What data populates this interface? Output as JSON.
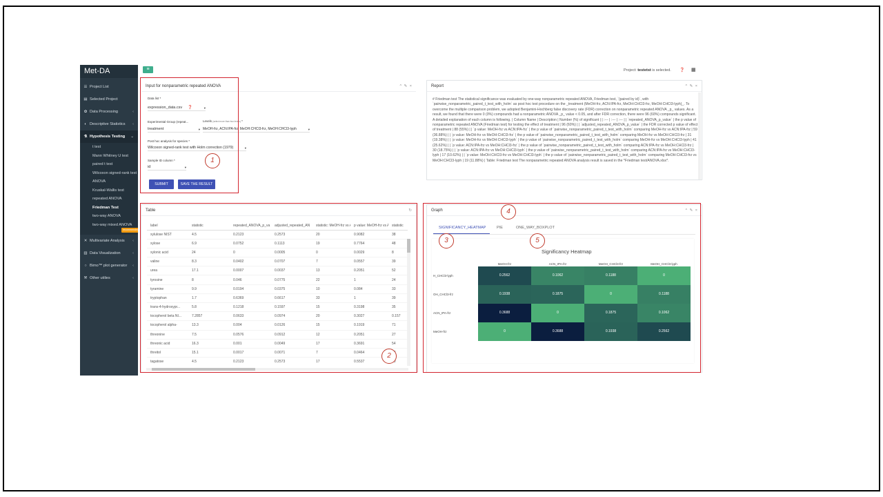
{
  "app": {
    "title": "Met-DA"
  },
  "sidebar": {
    "items": [
      {
        "label": "Project List",
        "icon": "list-icon"
      },
      {
        "label": "Selected Project",
        "icon": "file-icon"
      },
      {
        "label": "Data Processing",
        "icon": "gear-icon"
      },
      {
        "label": "Descriptive Statistics",
        "icon": "stats-icon"
      }
    ],
    "active": {
      "label": "Hypothesis Testing",
      "icon": "flask-icon"
    },
    "subitems": [
      "t test",
      "Mann Whitney U test",
      "paired t test",
      "Wilcoxon signed-rank test",
      "ANOVA",
      "Kruskal-Wallis test",
      "repeated ANOVA",
      "Friedman Test",
      "two-way ANOVA",
      "two-way mixed ANOVA"
    ],
    "sub_badge": "recommended",
    "items_after": [
      {
        "label": "Multivariate Analysis",
        "icon": "multivariate-icon"
      },
      {
        "label": "Data Visualization",
        "icon": "chart-icon"
      },
      {
        "label": "Bimo™ plot generator",
        "icon": "circle-icon"
      },
      {
        "label": "Other utilies",
        "icon": "wrench-icon"
      }
    ]
  },
  "topbar": {
    "status_prefix": "Project: ",
    "project_name": "testetst",
    "status_suffix": " is selected."
  },
  "input_panel": {
    "title": "Input for nonparametric repeated ANOVA",
    "data_list_label": "Data list *",
    "data_list_value": "expression_data.csv",
    "group_label": "Experimental Group (repeat...",
    "group_value": "treatment",
    "levels_label": "Levels",
    "levels_hint": "(select more than two levels)",
    "levels_req": " *",
    "levels_value": "MeOH-frz, ACN:IPA-frz, MeOH:CHCl3-frz, MeOH:CHCl3-lyph",
    "posthoc_label": "Post hoc analysis for species *",
    "posthoc_value": "Wilcoxon signed-rank test with Holm correction (1979)",
    "sample_label": "Sample ID column *",
    "sample_value": "id",
    "submit_label": "SUBMIT",
    "save_label": "SAVE THE RESULT"
  },
  "report_panel": {
    "title": "Report",
    "text": "# Friedman test The statistical significance was evaluated by one-way nonparametric repeated ANOVA, Friedman test, `(paired by id)`, with `pairwise_nonparametric_paired_t_test_with_holm` as post hoc test procedure on the _treatment (MeOH-frz, ACN:IPA-frz, MeOH:CHCl3-frz, MeOH:CHCl3-lyph)_. To overcome the multiple comparison problem, we adopted Benjamini-Hochberg false discovery rate (FDR) correction on nonparametric repeated ANOVA _p_ values. As a result, we found that there were 0 (0%) compounds had a nonparametric ANOVA _p_ value < 0.05, and after FDR correction, there were 96 (60%) compounds significant. A detailed explanation of each column is following. | Column Name | Description | Number (%) of significant | | :--- | :--- | :--- | | `repeated_ANOVA_p_value` | the p value of nonparametric repeated ANOVA (Friedman test) for testing the effect of treatment | 96 (60%) | | `adjusted_repeated_ANOVA_p_value` | the FDR corrected p value of effect of treatment | 88 (55%) | | `p value: MeOH-frz vs ACN:IPA-frz` | the p value of `pairwise_nonparametric_paired_t_test_with_holm` comparing MeOH-frz vs ACN:IPA-frz | 59 (36.88%) | | `p value: MeOH-frz vs MeOH:CHCl3-frz` | the p value of `pairwise_nonparametric_paired_t_test_with_holm` comparing MeOH-frz vs MeOH:CHCl3-frz | 31 (19.38%) | | `p value: MeOH-frz vs MeOH:CHCl3-lyph` | the p value of `pairwise_nonparametric_paired_t_test_with_holm` comparing MeOH-frz vs MeOH:CHCl3-lyph | 41 (25.62%) | | `p value: ACN:IPA-frz vs MeOH:CHCl3-frz` | the p value of `pairwise_nonparametric_paired_t_test_with_holm` comparing ACN:IPA-frz vs MeOH:CHCl3-frz | 30 (18.75%) | | `p value: ACN:IPA-frz vs MeOH:CHCl3-lyph` | the p value of `pairwise_nonparametric_paired_t_test_with_holm` comparing ACN:IPA-frz vs MeOH:CHCl3-lyph | 17 (10.62%) | | `p value: MeOH:CHCl3-frz vs MeOH:CHCl3-lyph` | the p value of `pairwise_nonparametric_paired_t_test_with_holm` comparing MeOH:CHCl3-frz vs MeOH:CHCl3-lyph | 19 (11.88%) | Table: Friedman test The nonparametric repeated ANOVA analysis result is saved in the *Friedman test/ANOVA.xlsx*."
  },
  "table_panel": {
    "title": "Table",
    "columns": [
      "label",
      "statistic",
      "repeated_ANOVA_p_va",
      "adjusted_repeated_AN",
      "statistic: MeOH-frz vs A",
      "p value: MeOH-frz vs A",
      "statistic"
    ],
    "rows": [
      [
        "xylulose NIST",
        "4.5",
        "0.2123",
        "0.2573",
        "20",
        "0.9082",
        "38"
      ],
      [
        "xylose",
        "6.9",
        "0.0752",
        "0.1113",
        "19",
        "0.7764",
        "48"
      ],
      [
        "xylonic acid",
        "24",
        "0",
        "0.0005",
        "0",
        "0.0029",
        "8"
      ],
      [
        "valine",
        "8.3",
        "0.0402",
        "0.0707",
        "7",
        "0.0557",
        "39"
      ],
      [
        "urea",
        "17.1",
        "0.0007",
        "0.0037",
        "13",
        "0.2051",
        "52"
      ],
      [
        "tyrosine",
        "8",
        "0.046",
        "0.0775",
        "22",
        "1",
        "24"
      ],
      [
        "tyramine",
        "9.9",
        "0.0194",
        "0.0375",
        "10",
        "0.084",
        "33"
      ],
      [
        "tryptophan",
        "1.7",
        "0.6369",
        "0.6617",
        "33",
        "1",
        "39"
      ],
      [
        "trans-4-hydroxypr...",
        "5.8",
        "0.1218",
        "0.1597",
        "15",
        "0.3198",
        "35"
      ],
      [
        "tocopherol beta NI...",
        "7.2857",
        "0.0633",
        "0.0974",
        "20",
        "0.3027",
        "0.157"
      ],
      [
        "tocopherol alpha-",
        "13.3",
        "0.004",
        "0.0126",
        "15",
        "0.1919",
        "71"
      ],
      [
        "threonine",
        "7.5",
        "0.0576",
        "0.0912",
        "12",
        "0.2051",
        "27"
      ],
      [
        "threonic acid",
        "16.3",
        "0.001",
        "0.0049",
        "17",
        "0.3691",
        "54"
      ],
      [
        "threitol",
        "15.1",
        "0.0017",
        "0.0071",
        "7",
        "0.0464",
        "38"
      ],
      [
        "tagatose",
        "4.5",
        "0.2123",
        "0.2573",
        "17",
        "0.5537",
        "30"
      ],
      [
        "sulfuric acid",
        "3.4",
        "0.334",
        "0.3685",
        "21",
        "1",
        "27"
      ]
    ]
  },
  "graph_panel": {
    "title": "Graph",
    "tabs": [
      "SIGNIFICANCY_HEATMAP",
      "PIE",
      "ONE_WAY_BOXPLOT"
    ],
    "active_tab": "SIGNIFICANCY_HEATMAP"
  },
  "chart_data": {
    "type": "heatmap",
    "title": "Significancy Heatmap",
    "x": [
      "MeOH-frz",
      "ACN_IPA-frz",
      "MeOH_CHCl3-frz",
      "MeOH_CHCl3-lyph"
    ],
    "y": [
      "H_CHCl3-lyph",
      "OH_CHCl3-frz",
      "ACN_IPA-frz",
      "MeOH-frz"
    ],
    "values": [
      [
        0.2562,
        0.1062,
        0.1188,
        0
      ],
      [
        0.1938,
        0.1875,
        0,
        0.1188
      ],
      [
        0.3688,
        0,
        0.1875,
        0.1062
      ],
      [
        0,
        0.3688,
        0.1938,
        0.2562
      ]
    ],
    "color_low": "#4caf76",
    "color_high": "#0b1e3f"
  },
  "callouts": [
    "1",
    "2",
    "3",
    "4",
    "5"
  ]
}
